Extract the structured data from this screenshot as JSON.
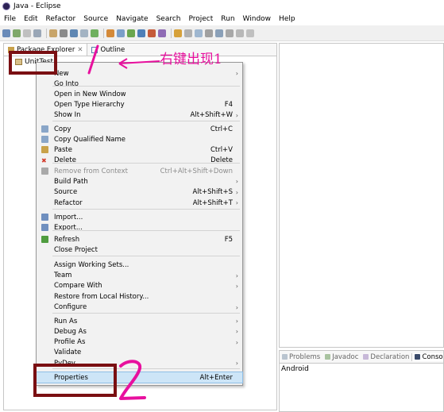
{
  "window": {
    "title": "Java - Eclipse"
  },
  "menubar": [
    "File",
    "Edit",
    "Refactor",
    "Source",
    "Navigate",
    "Search",
    "Project",
    "Run",
    "Window",
    "Help"
  ],
  "left_tabs": [
    {
      "label": "Package Explorer",
      "icon": "package-icon"
    },
    {
      "label": "Outline",
      "icon": "outline-icon"
    }
  ],
  "tree": {
    "project": "UnitTest"
  },
  "bottom_tabs": [
    {
      "label": "Problems",
      "icon": "problems-icon"
    },
    {
      "label": "Javadoc",
      "icon": "javadoc-icon"
    },
    {
      "label": "Declaration",
      "icon": "declaration-icon"
    },
    {
      "label": "Console",
      "icon": "console-icon"
    }
  ],
  "console_text": "Android",
  "context_menu": {
    "items": [
      {
        "label": "New",
        "shortcut": "",
        "submenu": true,
        "icon": ""
      },
      {
        "label": "Go Into",
        "shortcut": "",
        "submenu": false,
        "icon": ""
      },
      {
        "label": "Open in New Window",
        "shortcut": "",
        "submenu": false,
        "icon": ""
      },
      {
        "label": "Open Type Hierarchy",
        "shortcut": "F4",
        "submenu": false,
        "icon": ""
      },
      {
        "label": "Show In",
        "shortcut": "Alt+Shift+W",
        "submenu": true,
        "icon": ""
      },
      {
        "label": "Copy",
        "shortcut": "Ctrl+C",
        "submenu": false,
        "icon": "copy-icon"
      },
      {
        "label": "Copy Qualified Name",
        "shortcut": "",
        "submenu": false,
        "icon": "copy-qualified-icon"
      },
      {
        "label": "Paste",
        "shortcut": "Ctrl+V",
        "submenu": false,
        "icon": "paste-icon"
      },
      {
        "label": "Delete",
        "shortcut": "Delete",
        "submenu": false,
        "icon": "delete-icon"
      },
      {
        "label": "Remove from Context",
        "shortcut": "Ctrl+Alt+Shift+Down",
        "submenu": false,
        "icon": "remove-context-icon",
        "disabled": true
      },
      {
        "label": "Build Path",
        "shortcut": "",
        "submenu": true,
        "icon": ""
      },
      {
        "label": "Source",
        "shortcut": "Alt+Shift+S",
        "submenu": true,
        "icon": ""
      },
      {
        "label": "Refactor",
        "shortcut": "Alt+Shift+T",
        "submenu": true,
        "icon": ""
      },
      {
        "label": "Import...",
        "shortcut": "",
        "submenu": false,
        "icon": "import-icon"
      },
      {
        "label": "Export...",
        "shortcut": "",
        "submenu": false,
        "icon": "export-icon"
      },
      {
        "label": "Refresh",
        "shortcut": "F5",
        "submenu": false,
        "icon": "refresh-icon"
      },
      {
        "label": "Close Project",
        "shortcut": "",
        "submenu": false,
        "icon": ""
      },
      {
        "label": "Assign Working Sets...",
        "shortcut": "",
        "submenu": false,
        "icon": ""
      },
      {
        "label": "Team",
        "shortcut": "",
        "submenu": true,
        "icon": ""
      },
      {
        "label": "Compare With",
        "shortcut": "",
        "submenu": true,
        "icon": ""
      },
      {
        "label": "Restore from Local History...",
        "shortcut": "",
        "submenu": false,
        "icon": ""
      },
      {
        "label": "Configure",
        "shortcut": "",
        "submenu": true,
        "icon": ""
      },
      {
        "label": "Run As",
        "shortcut": "",
        "submenu": true,
        "icon": ""
      },
      {
        "label": "Debug As",
        "shortcut": "",
        "submenu": true,
        "icon": ""
      },
      {
        "label": "Profile As",
        "shortcut": "",
        "submenu": true,
        "icon": ""
      },
      {
        "label": "Validate",
        "shortcut": "",
        "submenu": false,
        "icon": ""
      },
      {
        "label": "PyDev",
        "shortcut": "",
        "submenu": true,
        "icon": ""
      },
      {
        "label": "Properties",
        "shortcut": "Alt+Enter",
        "submenu": false,
        "icon": "",
        "highlighted": true
      }
    ]
  },
  "annotation": {
    "text": "右键出现1",
    "color": "#e8109e",
    "box_color": "#7a0f12",
    "step2": "2"
  },
  "colors": {
    "highlight": "#cde5f7",
    "menu_bg": "#f2f2f2"
  }
}
